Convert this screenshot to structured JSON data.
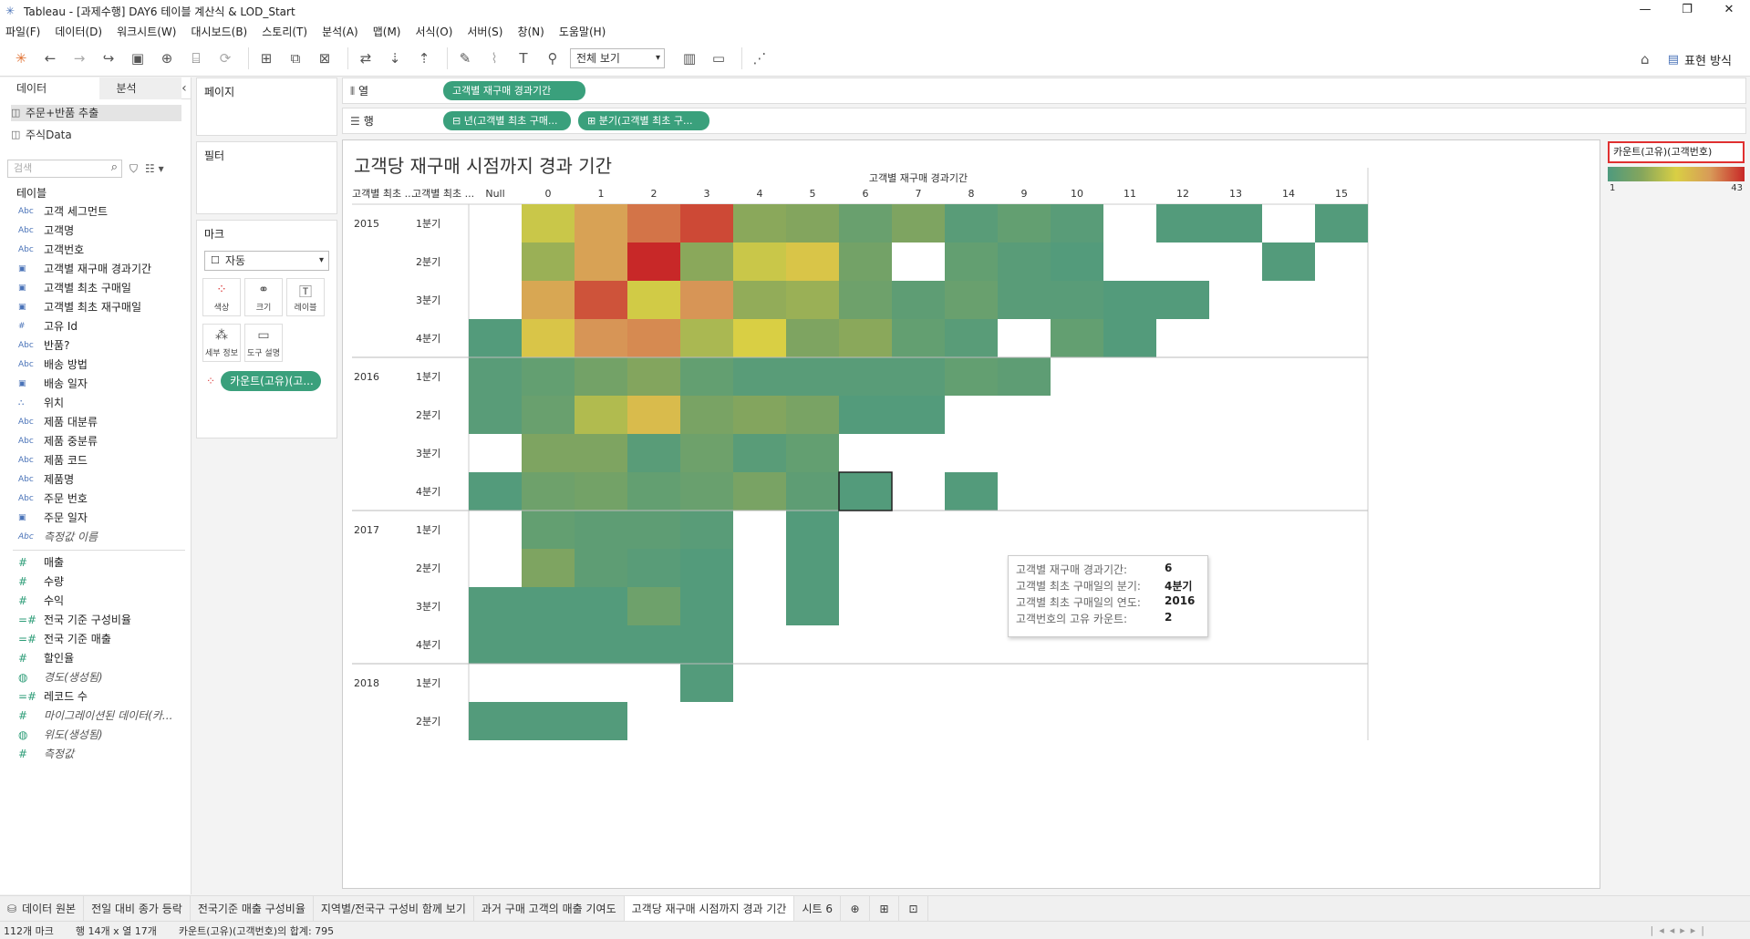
{
  "window": {
    "title": "Tableau - [과제수행] DAY6 테이블 계산식 & LOD_Start",
    "minimize": "—",
    "maximize": "❐",
    "close": "✕"
  },
  "menu": [
    "파일(F)",
    "데이터(D)",
    "워크시트(W)",
    "대시보드(B)",
    "스토리(T)",
    "분석(A)",
    "맵(M)",
    "서식(O)",
    "서버(S)",
    "창(N)",
    "도움말(H)"
  ],
  "toolbar": {
    "view_select": "전체 보기",
    "show_me_label": "표현 방식",
    "icons": [
      "tableau-logo-icon",
      "undo-icon",
      "redo-icon",
      "replay-icon",
      "save-icon",
      "new-datasource-icon",
      "pause-icon",
      "refresh-icon",
      "new-worksheet-icon",
      "duplicate-icon",
      "clear-icon",
      "swap-icon",
      "sort-asc-icon",
      "sort-desc-icon",
      "highlight-icon",
      "group-icon",
      "label-icon",
      "pin-icon",
      "chart-type-icon",
      "presentation-icon",
      "share-icon"
    ]
  },
  "left_pane": {
    "tab_data": "데이터",
    "tab_analysis": "분석",
    "collapse": "‹",
    "datasources": [
      {
        "name": "주문+반품 추출",
        "selected": true
      },
      {
        "name": "주식Data",
        "selected": false
      }
    ],
    "search_placeholder": "검색",
    "tables_label": "테이블",
    "dimensions": [
      {
        "type": "Abc",
        "name": "고객 세그먼트"
      },
      {
        "type": "Abc",
        "name": "고객명"
      },
      {
        "type": "Abc",
        "name": "고객번호"
      },
      {
        "type": "calc-date",
        "name": "고객별 재구매 경과기간"
      },
      {
        "type": "calc-date",
        "name": "고객별 최초 구매일"
      },
      {
        "type": "calc-date",
        "name": "고객별 최초 재구매일"
      },
      {
        "type": "#",
        "name": "고유 Id"
      },
      {
        "type": "Abc",
        "name": "반품?"
      },
      {
        "type": "Abc",
        "name": "배송 방법"
      },
      {
        "type": "date",
        "name": "배송 일자"
      },
      {
        "type": "geo",
        "name": "위치"
      },
      {
        "type": "Abc",
        "name": "제품 대분류"
      },
      {
        "type": "Abc",
        "name": "제품 중분류"
      },
      {
        "type": "Abc",
        "name": "제품 코드"
      },
      {
        "type": "Abc",
        "name": "제품명"
      },
      {
        "type": "Abc",
        "name": "주문 번호"
      },
      {
        "type": "date",
        "name": "주문 일자"
      },
      {
        "type": "Abc",
        "name": "측정값 이름",
        "italic": true
      }
    ],
    "measures": [
      {
        "type": "#",
        "name": "매출"
      },
      {
        "type": "#",
        "name": "수량"
      },
      {
        "type": "#",
        "name": "수익"
      },
      {
        "type": "=#",
        "name": "전국 기준 구성비율"
      },
      {
        "type": "=#",
        "name": "전국 기준 매출"
      },
      {
        "type": "#",
        "name": "할인율"
      },
      {
        "type": "globe",
        "name": "경도(생성됨)",
        "italic": true
      },
      {
        "type": "=#",
        "name": "레코드 수"
      },
      {
        "type": "#",
        "name": "마이그레이션된 데이터(카...",
        "italic": true
      },
      {
        "type": "globe",
        "name": "위도(생성됨)",
        "italic": true
      },
      {
        "type": "#",
        "name": "측정값",
        "italic": true
      }
    ]
  },
  "cards": {
    "pages": "페이지",
    "filters": "필터",
    "marks": "마크",
    "mark_type": "자동",
    "mark_buttons": [
      "색상",
      "크기",
      "레이블",
      "세부 정보",
      "도구 설명"
    ],
    "color_pill": "카운트(고유)(고..."
  },
  "shelves": {
    "columns_label": "열",
    "rows_label": "행",
    "columns_pills": [
      "고객별 재구매 경과기간"
    ],
    "rows_pills": [
      "⊟ 년(고객별 최초 구매...",
      "⊞ 분기(고객별 최초 구..."
    ]
  },
  "sheet": {
    "title": "고객당 재구매 시점까지 경과 기간",
    "col_header_title": "고객별 재구매 경과기간",
    "row_header_1": "고객별 최초 ...",
    "row_header_2": "고객별 최초 ..."
  },
  "legend": {
    "title": "카운트(고유)(고객번호)",
    "min": "1",
    "max": "43",
    "colors": [
      "#4e9a7e",
      "#86a65c",
      "#d9cf44",
      "#d89a58",
      "#c82828"
    ]
  },
  "tooltip": {
    "rows": [
      {
        "k": "고객별 재구매 경과기간:",
        "v": "6"
      },
      {
        "k": "고객별 최초 구매일의 분기:",
        "v": "4분기"
      },
      {
        "k": "고객별 최초 구매일의 연도:",
        "v": "2016"
      },
      {
        "k": "고객번호의 고유 카운트:",
        "v": "2"
      }
    ]
  },
  "chart_data": {
    "type": "heatmap",
    "title": "고객당 재구매 시점까지 경과 기간",
    "xlabel": "고객별 재구매 경과기간",
    "x": [
      "Null",
      "0",
      "1",
      "2",
      "3",
      "4",
      "5",
      "6",
      "7",
      "8",
      "9",
      "10",
      "11",
      "12",
      "13",
      "14",
      "15"
    ],
    "years": [
      {
        "year": "2015",
        "quarters": [
          "1분기",
          "2분기",
          "3분기",
          "4분기"
        ]
      },
      {
        "year": "2016",
        "quarters": [
          "1분기",
          "2분기",
          "3분기",
          "4분기"
        ]
      },
      {
        "year": "2017",
        "quarters": [
          "1분기",
          "2분기",
          "3분기",
          "4분기"
        ]
      },
      {
        "year": "2018",
        "quarters": [
          "1분기",
          "2분기"
        ]
      }
    ],
    "color_range": [
      1,
      43
    ],
    "values": [
      [
        null,
        20,
        31,
        36,
        40,
        12,
        11,
        6,
        10,
        3,
        5,
        3,
        null,
        2,
        2,
        null,
        2
      ],
      [
        null,
        14,
        31,
        43,
        12,
        20,
        24,
        8,
        null,
        5,
        3,
        2,
        null,
        null,
        null,
        2,
        null
      ],
      [
        null,
        30,
        39,
        21,
        33,
        13,
        14,
        7,
        4,
        6,
        3,
        3,
        2,
        2,
        null,
        null,
        null
      ],
      [
        2,
        24,
        33,
        34,
        16,
        22,
        10,
        12,
        5,
        3,
        null,
        5,
        2,
        null,
        null,
        null,
        null
      ],
      [
        3,
        5,
        8,
        11,
        5,
        3,
        3,
        3,
        3,
        5,
        4,
        null,
        null,
        null,
        null,
        null,
        null
      ],
      [
        3,
        6,
        17,
        26,
        9,
        11,
        9,
        2,
        2,
        null,
        null,
        null,
        null,
        null,
        null,
        null,
        null
      ],
      [
        null,
        10,
        10,
        3,
        7,
        3,
        5,
        null,
        null,
        null,
        null,
        null,
        null,
        null,
        null,
        null,
        null
      ],
      [
        2,
        7,
        8,
        5,
        6,
        9,
        4,
        2,
        null,
        2,
        null,
        null,
        null,
        null,
        null,
        null,
        null
      ],
      [
        null,
        5,
        4,
        4,
        3,
        null,
        2,
        null,
        null,
        null,
        null,
        null,
        null,
        null,
        null,
        null,
        null
      ],
      [
        null,
        10,
        4,
        3,
        2,
        null,
        2,
        null,
        null,
        null,
        null,
        null,
        null,
        null,
        null,
        null,
        null
      ],
      [
        2,
        2,
        2,
        7,
        2,
        null,
        2,
        null,
        null,
        null,
        null,
        null,
        null,
        null,
        null,
        null,
        null
      ],
      [
        2,
        2,
        2,
        2,
        2,
        null,
        null,
        null,
        null,
        null,
        null,
        null,
        null,
        null,
        null,
        null,
        null
      ],
      [
        null,
        null,
        null,
        null,
        2,
        null,
        null,
        null,
        null,
        null,
        null,
        null,
        null,
        null,
        null,
        null,
        null
      ],
      [
        2,
        2,
        2,
        null,
        null,
        null,
        null,
        null,
        null,
        null,
        null,
        null,
        null,
        null,
        null,
        null,
        null
      ]
    ]
  },
  "sheet_tabs": [
    {
      "label": "데이터 원본",
      "icon": "datasource-icon"
    },
    {
      "label": "전일 대비 종가 등락"
    },
    {
      "label": "전국기준 매출 구성비율"
    },
    {
      "label": "지역별/전국구 구성비 함께 보기"
    },
    {
      "label": "과거 구매 고객의 매출 기여도"
    },
    {
      "label": "고객당 재구매 시점까지 경과 기간",
      "active": true
    },
    {
      "label": "시트 6"
    }
  ],
  "status": {
    "marks": "112개 마크",
    "rows_cols": "행 14개 x 열 17개",
    "sum": "카운트(고유)(고객번호)의 합계: 795"
  }
}
